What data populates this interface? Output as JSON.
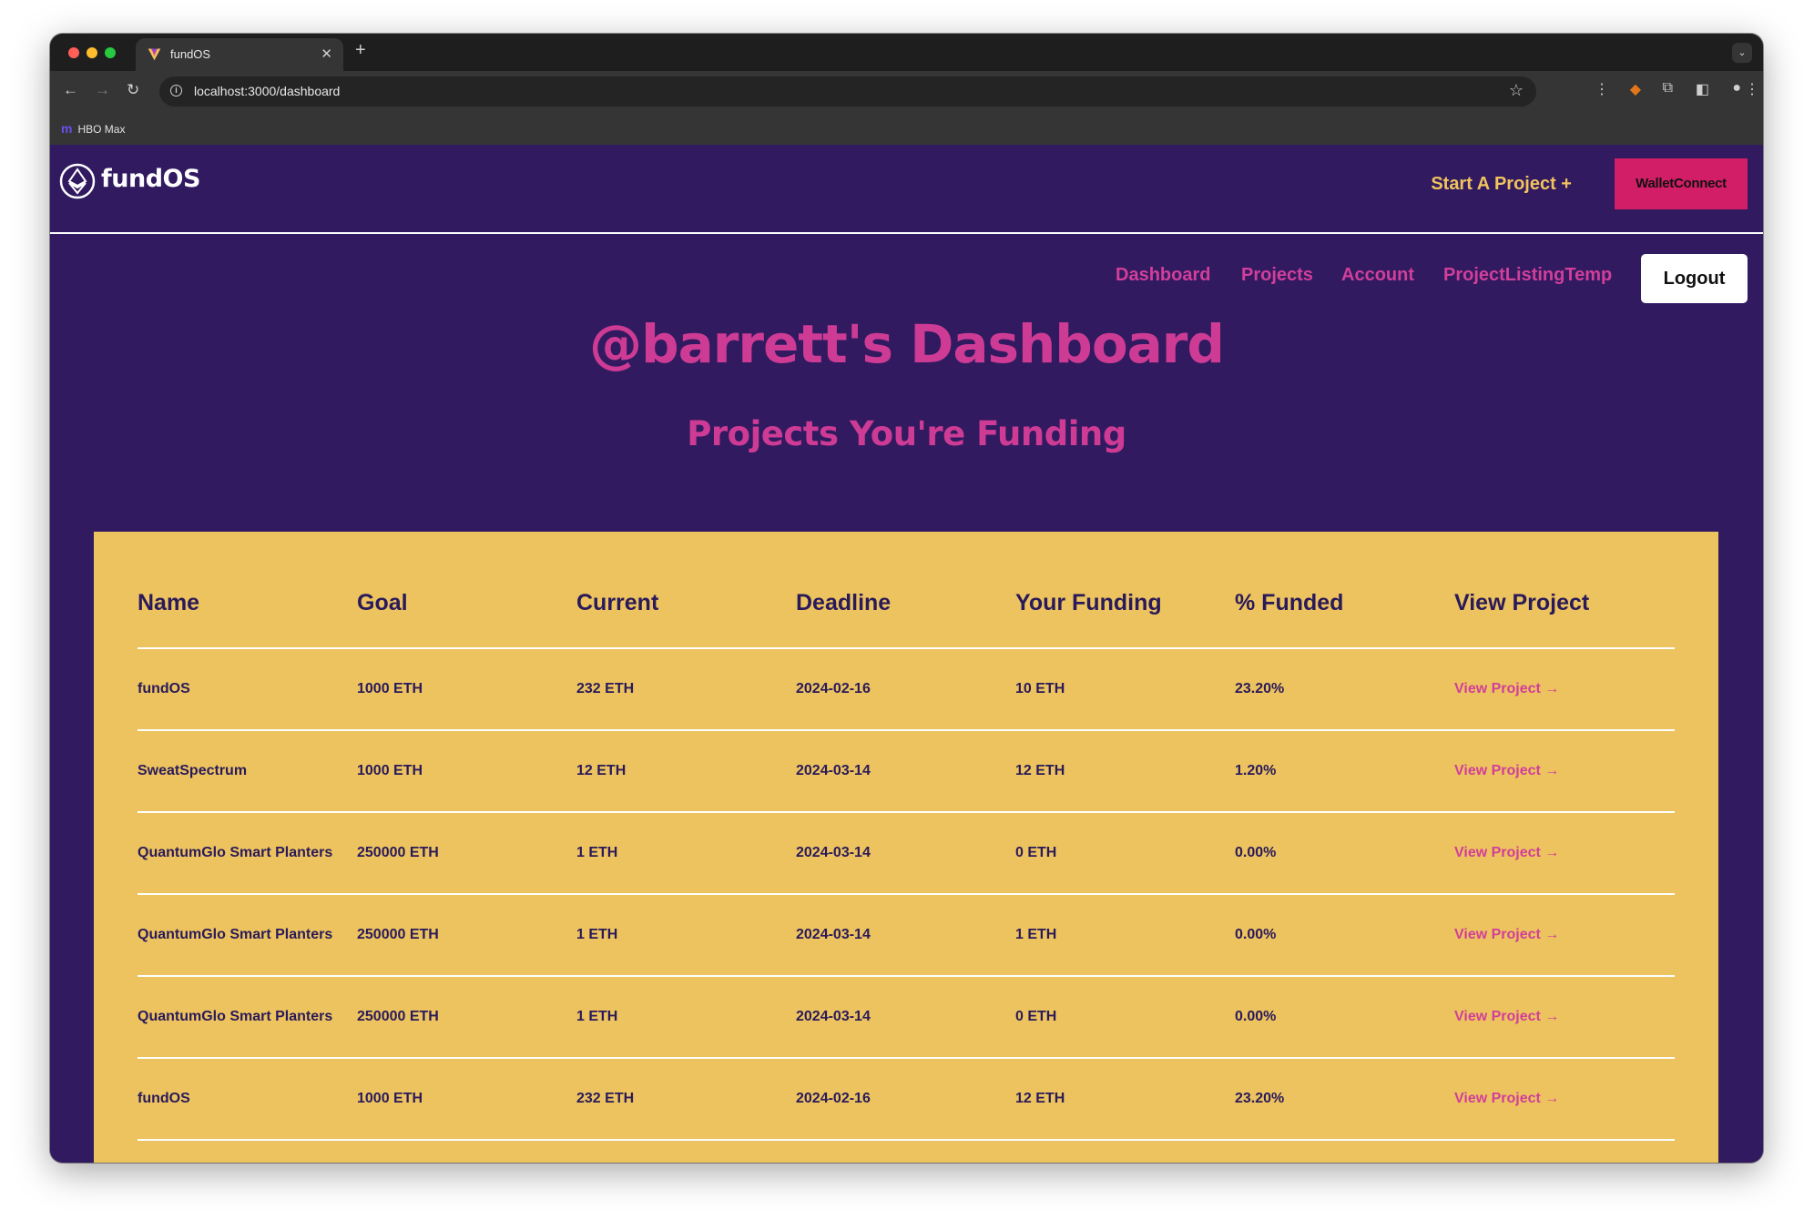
{
  "browser": {
    "tab_title": "fundOS",
    "tab_close": "✕",
    "new_tab": "+",
    "url": "localhost:3000/dashboard",
    "bookmarks": [
      {
        "label": "HBO Max"
      }
    ]
  },
  "header": {
    "logo_text": "fundOS",
    "start_project_label": "Start A Project +",
    "wallet_button_label": "WalletConnect"
  },
  "nav": {
    "links": [
      "Dashboard",
      "Projects",
      "Account",
      "ProjectListingTemp"
    ],
    "logout_label": "Logout"
  },
  "page": {
    "title": "@barrett's Dashboard",
    "section_title": "Projects You're Funding"
  },
  "table": {
    "columns": [
      "Name",
      "Goal",
      "Current",
      "Deadline",
      "Your Funding",
      "% Funded",
      "View Project"
    ],
    "rows": [
      {
        "name": "fundOS",
        "goal": "1000 ETH",
        "current": "232 ETH",
        "deadline": "2024-02-16",
        "your_funding": "10 ETH",
        "funded": "23.20%",
        "link": "View Project →"
      },
      {
        "name": "SweatSpectrum",
        "goal": "1000 ETH",
        "current": "12 ETH",
        "deadline": "2024-03-14",
        "your_funding": "12 ETH",
        "funded": "1.20%",
        "link": "View Project →"
      },
      {
        "name": "QuantumGlo Smart Planters",
        "goal": "250000 ETH",
        "current": "1 ETH",
        "deadline": "2024-03-14",
        "your_funding": "0 ETH",
        "funded": "0.00%",
        "link": "View Project →"
      },
      {
        "name": "QuantumGlo Smart Planters",
        "goal": "250000 ETH",
        "current": "1 ETH",
        "deadline": "2024-03-14",
        "your_funding": "1 ETH",
        "funded": "0.00%",
        "link": "View Project →"
      },
      {
        "name": "QuantumGlo Smart Planters",
        "goal": "250000 ETH",
        "current": "1 ETH",
        "deadline": "2024-03-14",
        "your_funding": "0 ETH",
        "funded": "0.00%",
        "link": "View Project →"
      },
      {
        "name": "fundOS",
        "goal": "1000 ETH",
        "current": "232 ETH",
        "deadline": "2024-02-16",
        "your_funding": "12 ETH",
        "funded": "23.20%",
        "link": "View Project →"
      }
    ]
  },
  "colors": {
    "app_bg": "#311a60",
    "accent_pink": "#d13f9a",
    "accent_yellow": "#f1c35e",
    "wallet_button": "#d21e66",
    "table_bg": "#ecc35e"
  }
}
